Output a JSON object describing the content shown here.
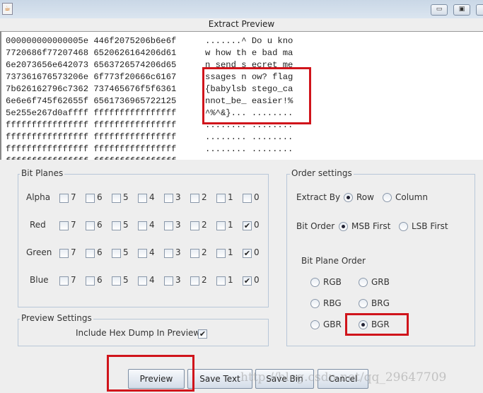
{
  "window": {
    "title": "Extract Preview",
    "icon": "java-icon",
    "buttons": [
      "minimize",
      "maximize",
      "close"
    ]
  },
  "preview": {
    "hex_lines": [
      "000000000000005e 446f2075206b6e6f",
      "7720686f77207468 6520626164206d61",
      "6e2073656e642073 6563726574206d65",
      "737361676573206e 6f773f20666c6167",
      "7b626162796c7362 737465676f5f6361",
      "6e6e6f745f62655f 6561736965722125",
      "5e255e267d0affff ffffffffffffffff",
      "ffffffffffffffff ffffffffffffffff",
      "ffffffffffffffff ffffffffffffffff",
      "ffffffffffffffff ffffffffffffffff",
      "ffffffffffffffff ffffffffffffffff"
    ],
    "ascii_lines": [
      ".......^ Do u kno",
      "w how th e bad ma",
      "n send s ecret me",
      "ssages n ow? flag",
      "{babylsb stego_ca",
      "nnot_be_ easier!%",
      "^%^&}... ........",
      "........ ........",
      "........ ........",
      "........ ........",
      "........ ........"
    ],
    "highlight_color": "#d0141b"
  },
  "bit_planes": {
    "title": "Bit Planes",
    "bits": [
      "7",
      "6",
      "5",
      "4",
      "3",
      "2",
      "1",
      "0"
    ],
    "channels": [
      {
        "name": "Alpha",
        "checked": [
          false,
          false,
          false,
          false,
          false,
          false,
          false,
          false
        ]
      },
      {
        "name": "Red",
        "checked": [
          false,
          false,
          false,
          false,
          false,
          false,
          false,
          true
        ]
      },
      {
        "name": "Green",
        "checked": [
          false,
          false,
          false,
          false,
          false,
          false,
          false,
          true
        ]
      },
      {
        "name": "Blue",
        "checked": [
          false,
          false,
          false,
          false,
          false,
          false,
          false,
          true
        ]
      }
    ]
  },
  "preview_settings": {
    "title": "Preview Settings",
    "hex_dump_label": "Include Hex Dump In Preview",
    "hex_dump_checked": true
  },
  "order_settings": {
    "title": "Order settings",
    "extract_by_label": "Extract By",
    "extract_by": [
      "Row",
      "Column"
    ],
    "extract_by_selected": "Row",
    "bit_order_label": "Bit Order",
    "bit_order": [
      "MSB First",
      "LSB First"
    ],
    "bit_order_selected": "MSB First",
    "plane_order_label": "Bit Plane Order",
    "plane_order": [
      "RGB",
      "GRB",
      "RBG",
      "BRG",
      "GBR",
      "BGR"
    ],
    "plane_order_selected": "BGR"
  },
  "buttons": {
    "preview": "Preview",
    "save_text": "Save Text",
    "save_bin": "Save Bin",
    "cancel": "Cancel"
  },
  "watermark": "http://blog.csdn.net/qq_29647709"
}
